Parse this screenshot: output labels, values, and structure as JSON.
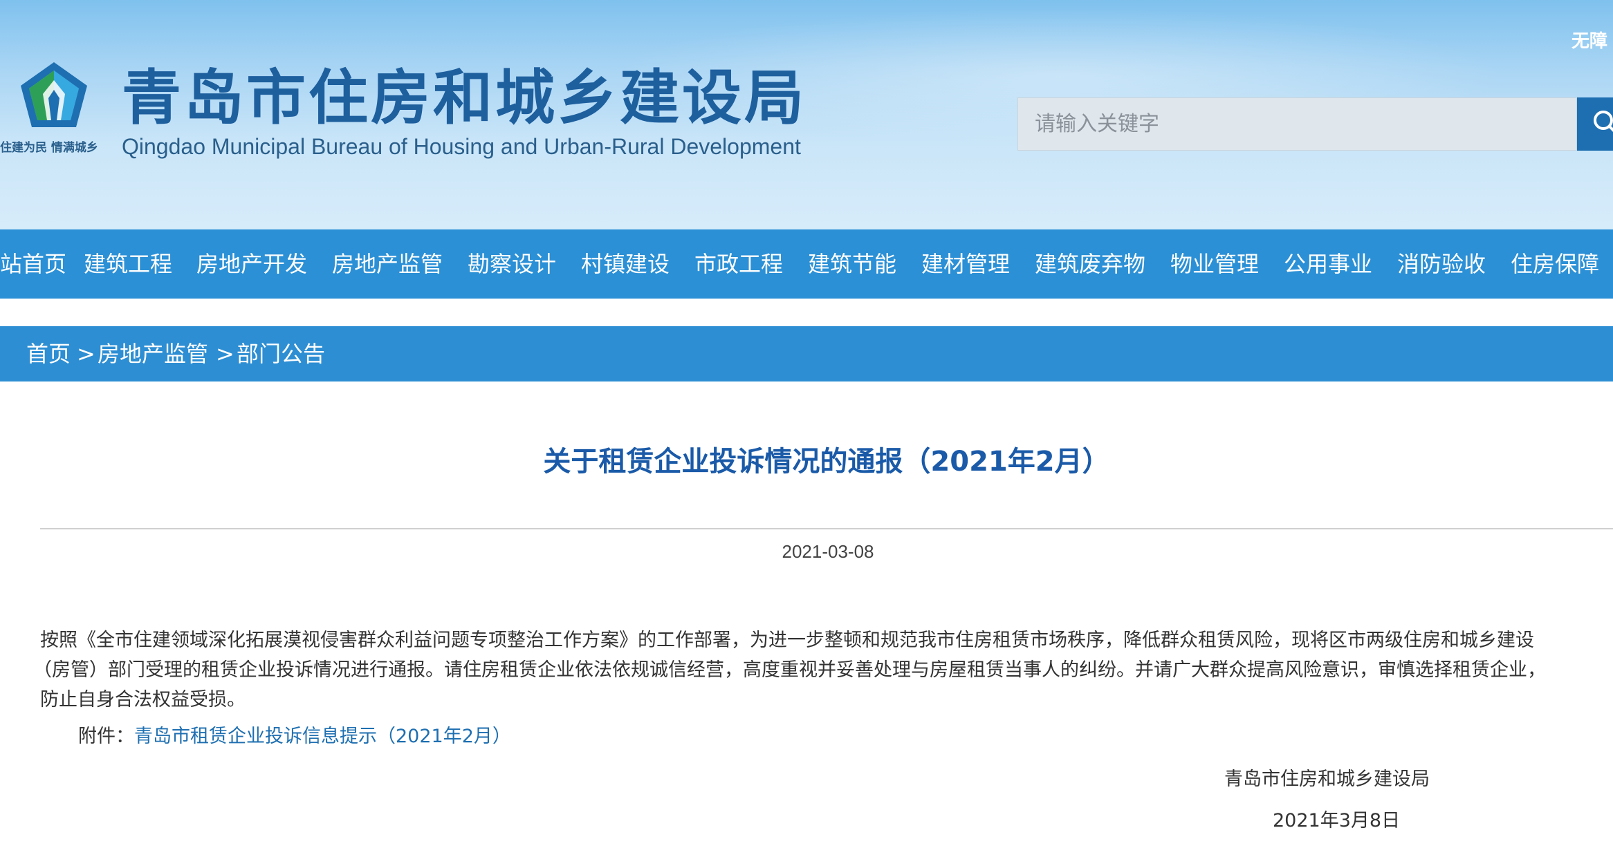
{
  "header": {
    "site_title": "青岛市住房和城乡建设局",
    "site_subtitle": "Qingdao Municipal Bureau of Housing and Urban-Rural Development",
    "slogan": "住建为民 情满城乡",
    "accessibility_label": "无障",
    "search": {
      "placeholder": "请输入关键字",
      "button_icon": "search-icon"
    },
    "logo_icon": "logo-emblem-icon"
  },
  "nav": {
    "items": [
      {
        "label": "网站首页"
      },
      {
        "label": "建筑工程"
      },
      {
        "label": "房地产开发"
      },
      {
        "label": "房地产监管"
      },
      {
        "label": "勘察设计"
      },
      {
        "label": "村镇建设"
      },
      {
        "label": "市政工程"
      },
      {
        "label": "建筑节能"
      },
      {
        "label": "建材管理"
      },
      {
        "label": "建筑废弃物"
      },
      {
        "label": "物业管理"
      },
      {
        "label": "公用事业"
      },
      {
        "label": "消防验收"
      },
      {
        "label": "住房保障"
      }
    ]
  },
  "breadcrumb": {
    "items": [
      "首页",
      "房地产监管",
      "部门公告"
    ],
    "separator": ">"
  },
  "article": {
    "title": "关于租赁企业投诉情况的通报（2021年2月）",
    "date": "2021-03-08",
    "body_lines": [
      "按照《全市住建领域深化拓展漠视侵害群众利益问题专项整治工作方案》的工作部署，为进一步整顿和规范我市住房租赁市场秩序，降低群众租赁风险，现将区市两级住房和城乡建设",
      "（房管）部门受理的租赁企业投诉情况进行通报。请住房租赁企业依法依规诚信经营，高度重视并妥善处理与房屋租赁当事人的纠纷。并请广大群众提高风险意识，审慎选择租赁企业，",
      "防止自身合法权益受损。"
    ],
    "attachment_label": "附件：",
    "attachment_link": "青岛市租赁企业投诉信息提示（2021年2月）",
    "signature_org": "青岛市住房和城乡建设局",
    "signature_date": "2021年3月8日"
  },
  "colors": {
    "nav_bg": "#2b90d6",
    "breadcrumb_bg": "#2d8ed3",
    "title": "#1a5aa8",
    "link": "#1e6fb1",
    "logo_green": "#2e9f57",
    "logo_blue": "#1e6fb1"
  }
}
